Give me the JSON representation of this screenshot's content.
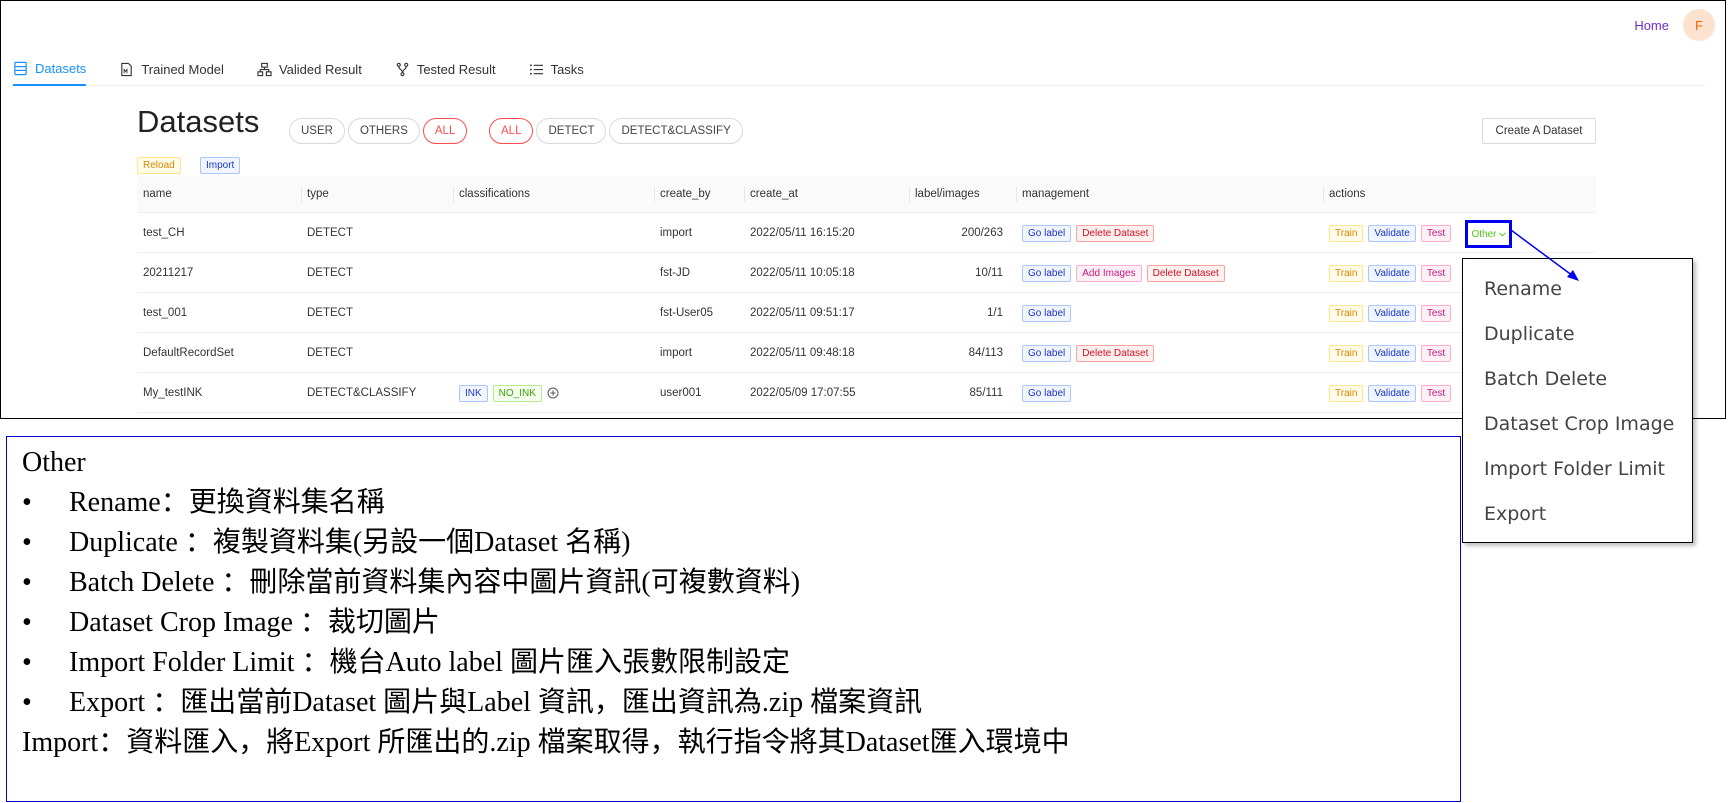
{
  "header": {
    "home_link": "Home",
    "avatar_initial": "F"
  },
  "nav": {
    "tabs": [
      {
        "label": "Datasets",
        "icon": "database-icon",
        "active": true
      },
      {
        "label": "Trained Model",
        "icon": "model-file-icon"
      },
      {
        "label": "Valided Result",
        "icon": "sitemap-icon"
      },
      {
        "label": "Tested Result",
        "icon": "branch-icon"
      },
      {
        "label": "Tasks",
        "icon": "list-icon"
      }
    ]
  },
  "page": {
    "title": "Datasets",
    "user_filters": [
      "USER",
      "OTHERS",
      "ALL"
    ],
    "user_filter_selected": "ALL",
    "type_filters": [
      "ALL",
      "DETECT",
      "DETECT&CLASSIFY"
    ],
    "type_filter_selected": "ALL",
    "create_button": "Create A Dataset",
    "reload_tag": "Reload",
    "import_tag": "Import"
  },
  "table": {
    "columns": [
      "name",
      "type",
      "classifications",
      "create_by",
      "create_at",
      "label/images",
      "management",
      "actions"
    ],
    "rows": [
      {
        "name": "test_CH",
        "type": "DETECT",
        "classifications": [],
        "create_by": "import",
        "create_at": "2022/05/11 16:15:20",
        "label_images": "200/263",
        "management": [
          "Go label",
          "Delete Dataset"
        ],
        "actions": [
          "Train",
          "Validate",
          "Test"
        ]
      },
      {
        "name": "20211217",
        "type": "DETECT",
        "classifications": [],
        "create_by": "fst-JD",
        "create_at": "2022/05/11 10:05:18",
        "label_images": "10/11",
        "management": [
          "Go label",
          "Add Images",
          "Delete Dataset"
        ],
        "actions": [
          "Train",
          "Validate",
          "Test"
        ]
      },
      {
        "name": "test_001",
        "type": "DETECT",
        "classifications": [],
        "create_by": "fst-User05",
        "create_at": "2022/05/11 09:51:17",
        "label_images": "1/1",
        "management": [
          "Go label"
        ],
        "actions": [
          "Train",
          "Validate",
          "Test"
        ]
      },
      {
        "name": "DefaultRecordSet",
        "type": "DETECT",
        "classifications": [],
        "create_by": "import",
        "create_at": "2022/05/11 09:48:18",
        "label_images": "84/113",
        "management": [
          "Go label",
          "Delete Dataset"
        ],
        "actions": [
          "Train",
          "Validate",
          "Test"
        ]
      },
      {
        "name": "My_testINK",
        "type": "DETECT&CLASSIFY",
        "classifications": [
          "INK",
          "NO_INK"
        ],
        "create_by": "user001",
        "create_at": "2022/05/09 17:07:55",
        "label_images": "85/111",
        "management": [
          "Go label"
        ],
        "actions": [
          "Train",
          "Validate",
          "Test"
        ]
      }
    ]
  },
  "other_button": "Other",
  "other_menu": [
    "Rename",
    "Duplicate",
    "Batch Delete",
    "Dataset Crop Image",
    "Import Folder Limit",
    "Export"
  ],
  "notes": {
    "title": "Other",
    "bullets": [
      "Rename：更換資料集名稱",
      "Duplicate ：複製資料集(另設一個Dataset 名稱)",
      "Batch Delete ：刪除當前資料集內容中圖片資訊(可複數資料)",
      "Dataset Crop Image ：裁切圖片",
      "Import Folder Limit ：機台Auto label 圖片匯入張數限制設定",
      "Export ：匯出當前Dataset 圖片與Label 資訊，匯出資訊為.zip 檔案資訊"
    ],
    "footer": "Import：資料匯入，將Export 所匯出的.zip 檔案取得，執行指令將其Dataset匯入環境中"
  },
  "colors": {
    "accent": "#1890ff",
    "selected_filter": "#ff4d4f",
    "home": "#722ed1",
    "highlight": "#0000ee"
  }
}
